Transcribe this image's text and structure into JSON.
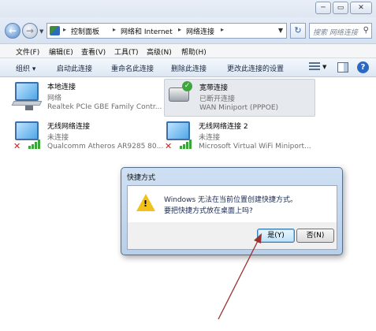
{
  "address": {
    "crumbs": [
      "控制面板",
      "网络和 Internet",
      "网络连接"
    ],
    "search_placeholder": "搜索 网络连接"
  },
  "menu": [
    "文件(F)",
    "编辑(E)",
    "查看(V)",
    "工具(T)",
    "高级(N)",
    "帮助(H)"
  ],
  "commands": {
    "organize": "组织 ▾",
    "start": "启动此连接",
    "rename": "重命名此连接",
    "delete": "删除此连接",
    "change": "更改此连接的设置"
  },
  "connections": [
    {
      "name": "本地连接",
      "status": "网络",
      "device": "Realtek PCIe GBE Family Contr..."
    },
    {
      "name": "宽带连接",
      "status": "已断开连接",
      "device": "WAN Miniport (PPPOE)"
    },
    {
      "name": "无线网络连接",
      "status": "未连接",
      "device": "Qualcomm Atheros AR9285 80..."
    },
    {
      "name": "无线网络连接 2",
      "status": "未连接",
      "device": "Microsoft Virtual WiFi Miniport..."
    }
  ],
  "dialog": {
    "title": "快捷方式",
    "line1": "Windows 无法在当前位置创建快捷方式。",
    "line2": "要把快捷方式放在桌面上吗?",
    "yes": "是(Y)",
    "no": "否(N)"
  },
  "colors": {
    "accent": "#2a69c3",
    "arrow": "#9b3030"
  }
}
